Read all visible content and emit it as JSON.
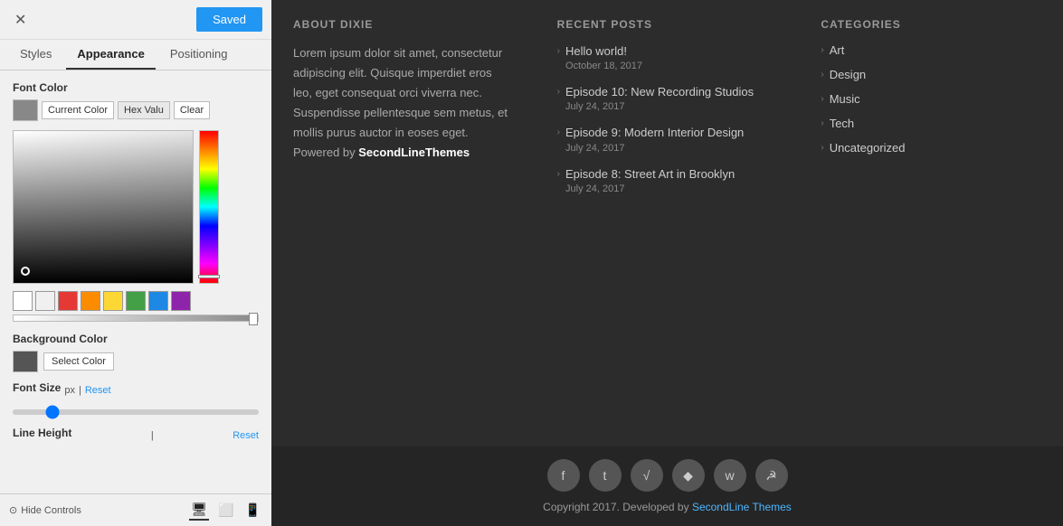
{
  "topBar": {
    "closeLabel": "✕",
    "savedLabel": "Saved"
  },
  "tabs": {
    "styles": "Styles",
    "appearance": "Appearance",
    "positioning": "Positioning"
  },
  "fontColor": {
    "sectionLabel": "Font Color",
    "currentColorLabel": "Current Color",
    "hexValueLabel": "Hex Valu",
    "clearLabel": "Clear"
  },
  "swatches": [
    {
      "color": "#ffffff"
    },
    {
      "color": "#f0f0f0"
    },
    {
      "color": "#e53935"
    },
    {
      "color": "#fb8c00"
    },
    {
      "color": "#fdd835"
    },
    {
      "color": "#43a047"
    },
    {
      "color": "#1e88e5"
    },
    {
      "color": "#8e24aa"
    }
  ],
  "backgroundColor": {
    "sectionLabel": "Background Color",
    "selectColorLabel": "Select Color"
  },
  "fontSize": {
    "sectionLabel": "Font Size",
    "unit": "px",
    "separator": "|",
    "resetLabel": "Reset"
  },
  "lineHeight": {
    "sectionLabel": "Line Height",
    "separator": "|",
    "resetLabel": "Reset"
  },
  "bottomBar": {
    "hideLabel": "Hide Controls",
    "desktopIcon": "🖥",
    "tabletIcon": "⬜",
    "mobileIcon": "📱"
  },
  "mainContent": {
    "col1": {
      "title": "ABOUT DIXIE",
      "body": "Lorem ipsum dolor sit amet, consectetur adipiscing elit. Quisque imperdiet eros leo, eget consequat orci viverra nec. Suspendisse pellentesque sem metus, et mollis purus auctor in eoses eget. Powered by ",
      "brandLink": "SecondLineThemes"
    },
    "col2": {
      "title": "RECENT POSTS",
      "posts": [
        {
          "title": "Hello world!",
          "date": "October 18, 2017"
        },
        {
          "title": "Episode 10: New Recording Studios",
          "date": "July 24, 2017"
        },
        {
          "title": "Episode 9: Modern Interior Design",
          "date": "July 24, 2017"
        },
        {
          "title": "Episode 8: Street Art in Brooklyn",
          "date": "July 24, 2017"
        }
      ]
    },
    "col3": {
      "title": "CATEGORIES",
      "categories": [
        {
          "name": "Art"
        },
        {
          "name": "Design"
        },
        {
          "name": "Music"
        },
        {
          "name": "Tech"
        },
        {
          "name": "Uncategorized"
        }
      ]
    }
  },
  "footer": {
    "copyright": "Copyright 2017. Developed by ",
    "copyrightLink": "SecondLine Themes",
    "socialIcons": [
      "f",
      "t",
      "r",
      "p",
      "w",
      "c"
    ]
  }
}
